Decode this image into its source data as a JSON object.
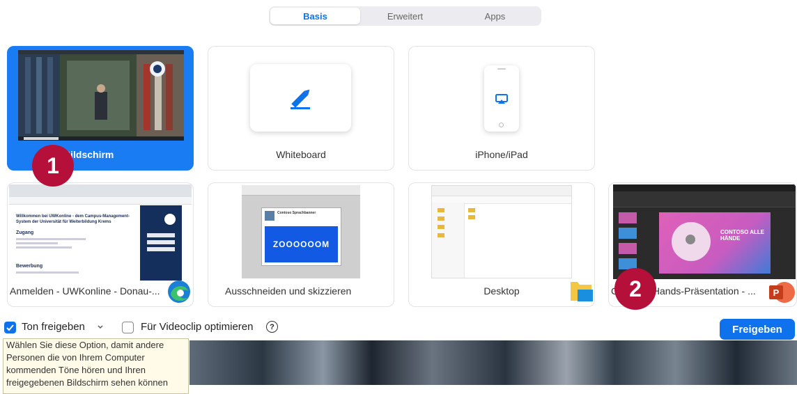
{
  "tabs": [
    {
      "label": "Basis",
      "active": true
    },
    {
      "label": "Erweitert",
      "active": false
    },
    {
      "label": "Apps",
      "active": false
    }
  ],
  "cards": {
    "screen": {
      "label": "Bildschirm",
      "selected": true
    },
    "whiteboard": {
      "label": "Whiteboard"
    },
    "iphone": {
      "label": "iPhone/iPad"
    },
    "browser": {
      "label": "Anmelden - UWKonline - Donau-...",
      "icon": "edge-icon"
    },
    "snipping": {
      "label": "Ausschneiden und skizzieren"
    },
    "desktop": {
      "label": "Desktop",
      "icon": "folder-icon"
    },
    "powerpoint": {
      "label": "Contoso All-Hands-Präsentation - ...",
      "visible_label": "C          ll-Hands-Präsentation - ...",
      "icon": "powerpoint-icon"
    }
  },
  "thumbs": {
    "browser_heading": "Willkommen bei UWKonline - dem Campus-Management-System der Universität für Weiterbildung Krems",
    "browser_section1": "Zugang",
    "browser_section2": "Bewerbung",
    "snip_title": "Contoso Sprachbanner",
    "snip_logo": "ZOOOOOOM",
    "ppt_title": "CONTOSO ALLE HÄNDE"
  },
  "badges": {
    "one": "1",
    "two": "2"
  },
  "bottom": {
    "audio_label": "Ton freigeben",
    "audio_checked": true,
    "video_label": "Für Videoclip optimieren",
    "video_checked": false,
    "help_icon": "?",
    "share_button": "Freigeben"
  },
  "tooltip": {
    "text": "Wählen Sie diese Option, damit andere Personen die von Ihrem Computer kommenden Töne hören und Ihren freigegebenen Bildschirm sehen können"
  },
  "colors": {
    "accent": "#0e72ed",
    "selected": "#1a7cf2",
    "badge": "#b5103a"
  }
}
